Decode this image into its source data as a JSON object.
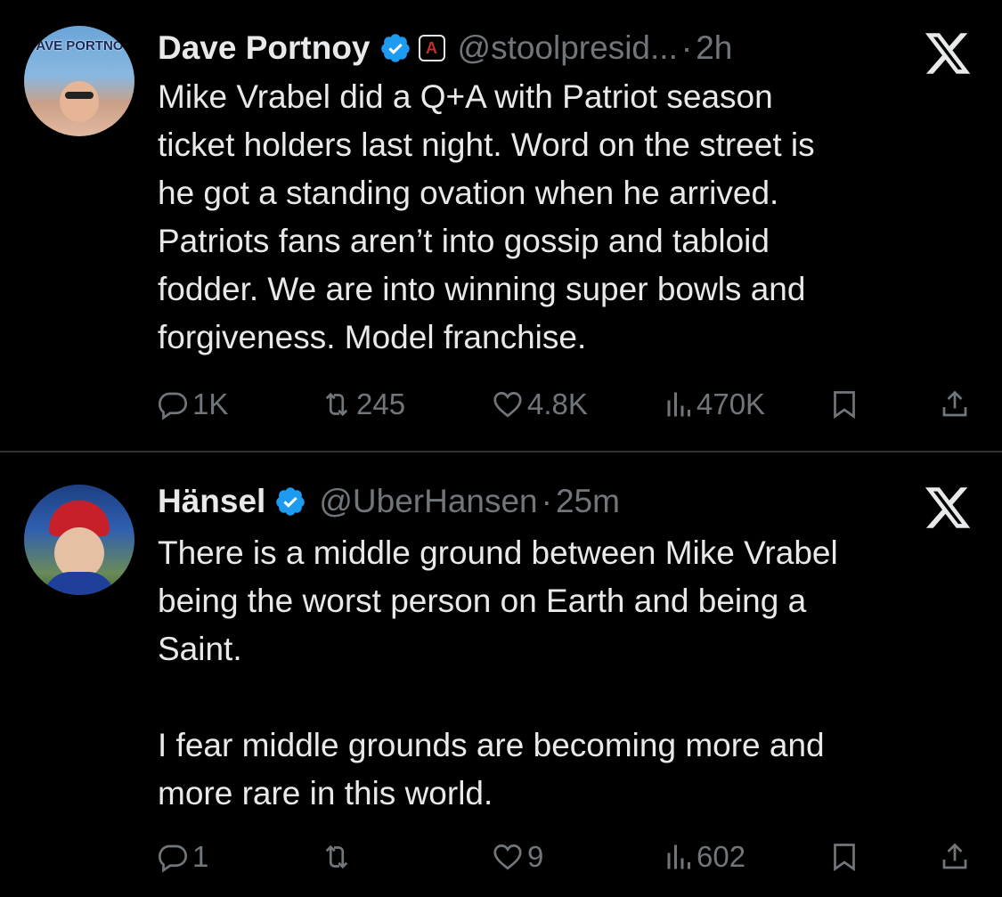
{
  "tweets": [
    {
      "avatar_text": "DAVE\nPORTNOY",
      "name": "Dave Portnoy",
      "handle": "@stoolpresid...",
      "separator": "·",
      "time": "2h",
      "text": "Mike Vrabel did a Q+A with Patriot season\nticket holders last night.  Word on the street is\nhe got a standing ovation when he arrived.\nPatriots fans aren’t into gossip and tabloid\nfodder.   We are into winning super bowls and\nforgiveness.   Model franchise.",
      "replies": "1K",
      "retweets": "245",
      "likes": "4.8K",
      "views": "470K"
    },
    {
      "name": "Hänsel",
      "handle": "@UberHansen",
      "separator": "·",
      "time": "25m",
      "text": "There is a middle ground between Mike Vrabel\nbeing the worst person on Earth and being a\nSaint.\n\nI fear middle grounds are becoming more and\nmore rare in this world.",
      "replies": "1",
      "retweets": "",
      "likes": "9",
      "views": "602"
    }
  ],
  "icons": {
    "verified": "verified-badge-icon",
    "affiliate": "barstool-affiliate-badge",
    "x_logo": "x-logo-icon",
    "reply": "reply-icon",
    "retweet": "retweet-icon",
    "like": "heart-icon",
    "views": "views-chart-icon",
    "bookmark": "bookmark-icon",
    "share": "share-icon"
  },
  "colors": {
    "background": "#000000",
    "text": "#e7e9ea",
    "secondary": "#71767b",
    "verified": "#1d9bf0",
    "divider": "#2f3336"
  }
}
